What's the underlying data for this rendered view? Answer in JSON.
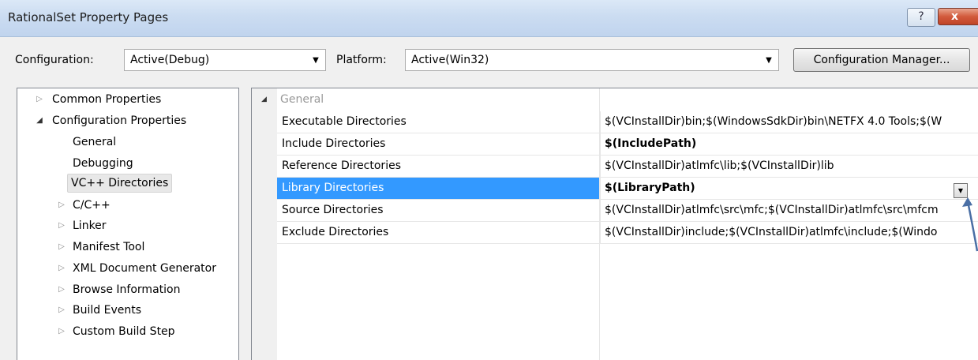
{
  "window": {
    "title": "RationalSet Property Pages",
    "help_label": "?",
    "close_label": "x"
  },
  "toolbar": {
    "configuration_label": "Configuration:",
    "configuration_value": "Active(Debug)",
    "platform_label": "Platform:",
    "platform_value": "Active(Win32)",
    "config_manager_label": "Configuration Manager..."
  },
  "tree": {
    "items": [
      {
        "label": "Common Properties",
        "expander": "collapsed"
      },
      {
        "label": "Configuration Properties",
        "expander": "expanded"
      },
      {
        "label": "General",
        "expander": "none"
      },
      {
        "label": "Debugging",
        "expander": "none"
      },
      {
        "label": "VC++ Directories",
        "expander": "none",
        "selected": true
      },
      {
        "label": "C/C++",
        "expander": "collapsed"
      },
      {
        "label": "Linker",
        "expander": "collapsed"
      },
      {
        "label": "Manifest Tool",
        "expander": "collapsed"
      },
      {
        "label": "XML Document Generator",
        "expander": "collapsed"
      },
      {
        "label": "Browse Information",
        "expander": "collapsed"
      },
      {
        "label": "Build Events",
        "expander": "collapsed"
      },
      {
        "label": "Custom Build Step",
        "expander": "collapsed"
      }
    ]
  },
  "grid": {
    "category": "General",
    "rows": [
      {
        "name": "Executable Directories",
        "value": "$(VCInstallDir)bin;$(WindowsSdkDir)bin\\NETFX 4.0 Tools;$(W"
      },
      {
        "name": "Include Directories",
        "value": "$(IncludePath)",
        "bold": true
      },
      {
        "name": "Reference Directories",
        "value": "$(VCInstallDir)atlmfc\\lib;$(VCInstallDir)lib"
      },
      {
        "name": "Library Directories",
        "value": "$(LibraryPath)",
        "bold": true,
        "selected": true
      },
      {
        "name": "Source Directories",
        "value": "$(VCInstallDir)atlmfc\\src\\mfc;$(VCInstallDir)atlmfc\\src\\mfcm"
      },
      {
        "name": "Exclude Directories",
        "value": "$(VCInstallDir)include;$(VCInstallDir)atlmfc\\include;$(Windo"
      }
    ]
  },
  "colors": {
    "selection": "#3399ff",
    "annotation_arrow": "#4a6fa5"
  }
}
